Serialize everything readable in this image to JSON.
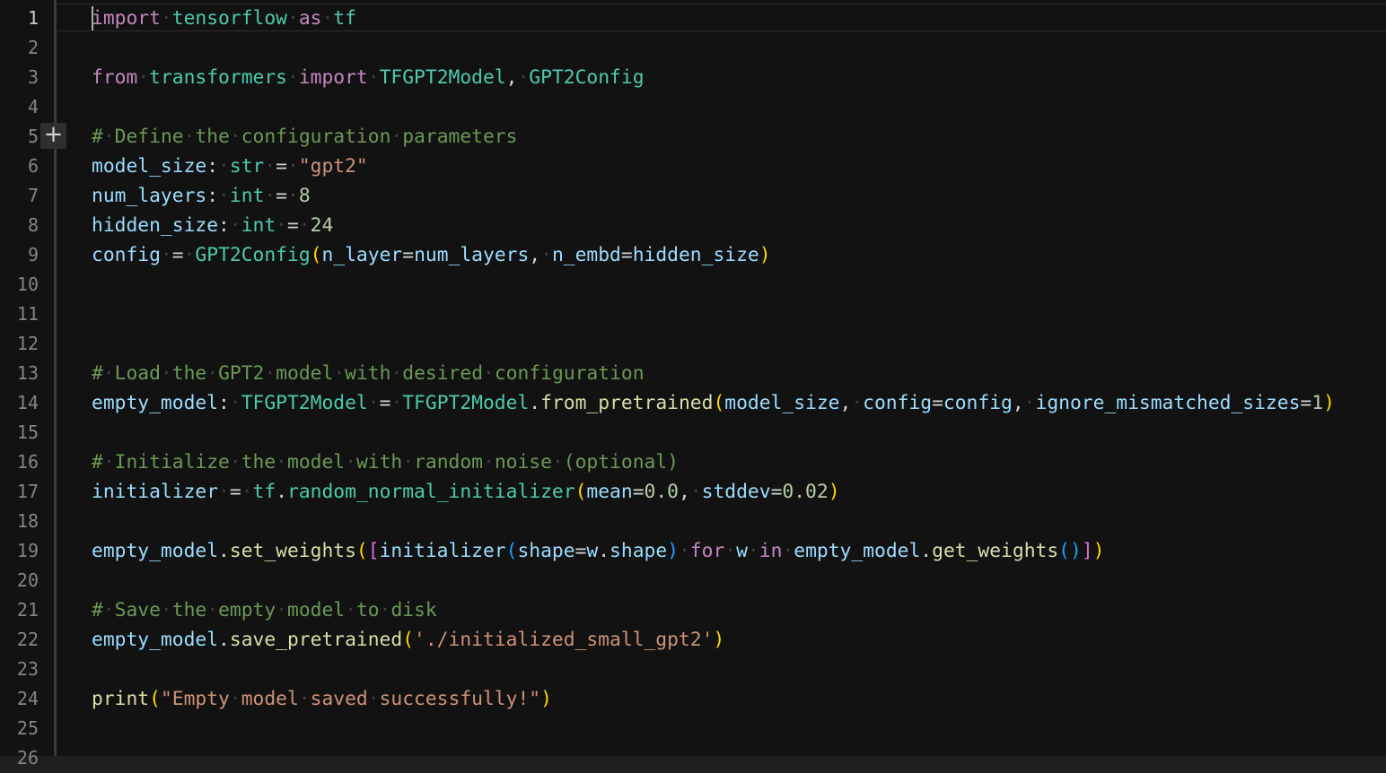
{
  "editor": {
    "line_numbers": [
      "1",
      "2",
      "3",
      "4",
      "5",
      "6",
      "7",
      "8",
      "9",
      "10",
      "11",
      "12",
      "13",
      "14",
      "15",
      "16",
      "17",
      "18",
      "19",
      "20",
      "21",
      "22",
      "23",
      "24",
      "25",
      "26"
    ],
    "active_line": 1,
    "gutter_action_icon": "add-icon",
    "code_lines": [
      {
        "line": 1,
        "tokens": [
          {
            "t": "import",
            "c": "kw-import"
          },
          {
            "t": "·",
            "c": "ws"
          },
          {
            "t": "tensorflow",
            "c": "ty"
          },
          {
            "t": "·",
            "c": "ws"
          },
          {
            "t": "as",
            "c": "kw-import"
          },
          {
            "t": "·",
            "c": "ws"
          },
          {
            "t": "tf",
            "c": "ty"
          }
        ]
      },
      {
        "line": 3,
        "tokens": [
          {
            "t": "from",
            "c": "kw-import"
          },
          {
            "t": "·",
            "c": "ws"
          },
          {
            "t": "transformers",
            "c": "ty"
          },
          {
            "t": "·",
            "c": "ws"
          },
          {
            "t": "import",
            "c": "kw-import"
          },
          {
            "t": "·",
            "c": "ws"
          },
          {
            "t": "TFGPT2Model",
            "c": "ty"
          },
          {
            "t": ",",
            "c": "op"
          },
          {
            "t": "·",
            "c": "ws"
          },
          {
            "t": "GPT2Config",
            "c": "ty"
          }
        ]
      },
      {
        "line": 5,
        "tokens": [
          {
            "t": "#",
            "c": "cm"
          },
          {
            "t": "·",
            "c": "ws"
          },
          {
            "t": "Define",
            "c": "cm"
          },
          {
            "t": "·",
            "c": "ws"
          },
          {
            "t": "the",
            "c": "cm"
          },
          {
            "t": "·",
            "c": "ws"
          },
          {
            "t": "configuration",
            "c": "cm"
          },
          {
            "t": "·",
            "c": "ws"
          },
          {
            "t": "parameters",
            "c": "cm"
          }
        ]
      },
      {
        "line": 6,
        "tokens": [
          {
            "t": "model_size",
            "c": "var"
          },
          {
            "t": ":",
            "c": "op"
          },
          {
            "t": "·",
            "c": "ws"
          },
          {
            "t": "str",
            "c": "ty"
          },
          {
            "t": "·",
            "c": "ws"
          },
          {
            "t": "=",
            "c": "op"
          },
          {
            "t": "·",
            "c": "ws"
          },
          {
            "t": "\"gpt2\"",
            "c": "str"
          }
        ]
      },
      {
        "line": 7,
        "tokens": [
          {
            "t": "num_layers",
            "c": "var"
          },
          {
            "t": ":",
            "c": "op"
          },
          {
            "t": "·",
            "c": "ws"
          },
          {
            "t": "int",
            "c": "ty"
          },
          {
            "t": "·",
            "c": "ws"
          },
          {
            "t": "=",
            "c": "op"
          },
          {
            "t": "·",
            "c": "ws"
          },
          {
            "t": "8",
            "c": "num"
          }
        ]
      },
      {
        "line": 8,
        "tokens": [
          {
            "t": "hidden_size",
            "c": "var"
          },
          {
            "t": ":",
            "c": "op"
          },
          {
            "t": "·",
            "c": "ws"
          },
          {
            "t": "int",
            "c": "ty"
          },
          {
            "t": "·",
            "c": "ws"
          },
          {
            "t": "=",
            "c": "op"
          },
          {
            "t": "·",
            "c": "ws"
          },
          {
            "t": "24",
            "c": "num"
          }
        ]
      },
      {
        "line": 9,
        "tokens": [
          {
            "t": "config",
            "c": "var"
          },
          {
            "t": "·",
            "c": "ws"
          },
          {
            "t": "=",
            "c": "op"
          },
          {
            "t": "·",
            "c": "ws"
          },
          {
            "t": "GPT2Config",
            "c": "ty"
          },
          {
            "t": "(",
            "c": "br1"
          },
          {
            "t": "n_layer",
            "c": "var"
          },
          {
            "t": "=",
            "c": "op"
          },
          {
            "t": "num_layers",
            "c": "var"
          },
          {
            "t": ",",
            "c": "op"
          },
          {
            "t": "·",
            "c": "ws"
          },
          {
            "t": "n_embd",
            "c": "var"
          },
          {
            "t": "=",
            "c": "op"
          },
          {
            "t": "hidden_size",
            "c": "var"
          },
          {
            "t": ")",
            "c": "br1"
          }
        ]
      },
      {
        "line": 13,
        "tokens": [
          {
            "t": "#",
            "c": "cm"
          },
          {
            "t": "·",
            "c": "ws"
          },
          {
            "t": "Load",
            "c": "cm"
          },
          {
            "t": "·",
            "c": "ws"
          },
          {
            "t": "the",
            "c": "cm"
          },
          {
            "t": "·",
            "c": "ws"
          },
          {
            "t": "GPT2",
            "c": "cm"
          },
          {
            "t": "·",
            "c": "ws"
          },
          {
            "t": "model",
            "c": "cm"
          },
          {
            "t": "·",
            "c": "ws"
          },
          {
            "t": "with",
            "c": "cm"
          },
          {
            "t": "·",
            "c": "ws"
          },
          {
            "t": "desired",
            "c": "cm"
          },
          {
            "t": "·",
            "c": "ws"
          },
          {
            "t": "configuration",
            "c": "cm"
          }
        ]
      },
      {
        "line": 14,
        "tokens": [
          {
            "t": "empty_model",
            "c": "var"
          },
          {
            "t": ":",
            "c": "op"
          },
          {
            "t": "·",
            "c": "ws"
          },
          {
            "t": "TFGPT2Model",
            "c": "ty"
          },
          {
            "t": "·",
            "c": "ws"
          },
          {
            "t": "=",
            "c": "op"
          },
          {
            "t": "·",
            "c": "ws"
          },
          {
            "t": "TFGPT2Model",
            "c": "ty"
          },
          {
            "t": ".",
            "c": "op"
          },
          {
            "t": "from_pretrained",
            "c": "fn"
          },
          {
            "t": "(",
            "c": "br1"
          },
          {
            "t": "model_size",
            "c": "var"
          },
          {
            "t": ",",
            "c": "op"
          },
          {
            "t": "·",
            "c": "ws"
          },
          {
            "t": "config",
            "c": "var"
          },
          {
            "t": "=",
            "c": "op"
          },
          {
            "t": "config",
            "c": "var"
          },
          {
            "t": ",",
            "c": "op"
          },
          {
            "t": "·",
            "c": "ws"
          },
          {
            "t": "ignore_mismatched_sizes",
            "c": "var"
          },
          {
            "t": "=",
            "c": "op"
          },
          {
            "t": "1",
            "c": "num"
          },
          {
            "t": ")",
            "c": "br1"
          }
        ]
      },
      {
        "line": 16,
        "tokens": [
          {
            "t": "#",
            "c": "cm"
          },
          {
            "t": "·",
            "c": "ws"
          },
          {
            "t": "Initialize",
            "c": "cm"
          },
          {
            "t": "·",
            "c": "ws"
          },
          {
            "t": "the",
            "c": "cm"
          },
          {
            "t": "·",
            "c": "ws"
          },
          {
            "t": "model",
            "c": "cm"
          },
          {
            "t": "·",
            "c": "ws"
          },
          {
            "t": "with",
            "c": "cm"
          },
          {
            "t": "·",
            "c": "ws"
          },
          {
            "t": "random",
            "c": "cm"
          },
          {
            "t": "·",
            "c": "ws"
          },
          {
            "t": "noise",
            "c": "cm"
          },
          {
            "t": "·",
            "c": "ws"
          },
          {
            "t": "(optional)",
            "c": "cm"
          }
        ]
      },
      {
        "line": 17,
        "tokens": [
          {
            "t": "initializer",
            "c": "var"
          },
          {
            "t": "·",
            "c": "ws"
          },
          {
            "t": "=",
            "c": "op"
          },
          {
            "t": "·",
            "c": "ws"
          },
          {
            "t": "tf",
            "c": "ty"
          },
          {
            "t": ".",
            "c": "op"
          },
          {
            "t": "random_normal_initializer",
            "c": "ty"
          },
          {
            "t": "(",
            "c": "br1"
          },
          {
            "t": "mean",
            "c": "var"
          },
          {
            "t": "=",
            "c": "op"
          },
          {
            "t": "0.0",
            "c": "num"
          },
          {
            "t": ",",
            "c": "op"
          },
          {
            "t": "·",
            "c": "ws"
          },
          {
            "t": "stddev",
            "c": "var"
          },
          {
            "t": "=",
            "c": "op"
          },
          {
            "t": "0.02",
            "c": "num"
          },
          {
            "t": ")",
            "c": "br1"
          }
        ]
      },
      {
        "line": 19,
        "tokens": [
          {
            "t": "empty_model",
            "c": "var"
          },
          {
            "t": ".",
            "c": "op"
          },
          {
            "t": "set_weights",
            "c": "fn"
          },
          {
            "t": "(",
            "c": "br1"
          },
          {
            "t": "[",
            "c": "br2"
          },
          {
            "t": "initializer",
            "c": "var"
          },
          {
            "t": "(",
            "c": "br3"
          },
          {
            "t": "shape",
            "c": "var"
          },
          {
            "t": "=",
            "c": "op"
          },
          {
            "t": "w",
            "c": "var"
          },
          {
            "t": ".",
            "c": "op"
          },
          {
            "t": "shape",
            "c": "var"
          },
          {
            "t": ")",
            "c": "br3"
          },
          {
            "t": "·",
            "c": "ws"
          },
          {
            "t": "for",
            "c": "kw-import"
          },
          {
            "t": "·",
            "c": "ws"
          },
          {
            "t": "w",
            "c": "var"
          },
          {
            "t": "·",
            "c": "ws"
          },
          {
            "t": "in",
            "c": "kw-import"
          },
          {
            "t": "·",
            "c": "ws"
          },
          {
            "t": "empty_model",
            "c": "var"
          },
          {
            "t": ".",
            "c": "op"
          },
          {
            "t": "get_weights",
            "c": "fn"
          },
          {
            "t": "()",
            "c": "br3"
          },
          {
            "t": "]",
            "c": "br2"
          },
          {
            "t": ")",
            "c": "br1"
          }
        ]
      },
      {
        "line": 21,
        "tokens": [
          {
            "t": "#",
            "c": "cm"
          },
          {
            "t": "·",
            "c": "ws"
          },
          {
            "t": "Save",
            "c": "cm"
          },
          {
            "t": "·",
            "c": "ws"
          },
          {
            "t": "the",
            "c": "cm"
          },
          {
            "t": "·",
            "c": "ws"
          },
          {
            "t": "empty",
            "c": "cm"
          },
          {
            "t": "·",
            "c": "ws"
          },
          {
            "t": "model",
            "c": "cm"
          },
          {
            "t": "·",
            "c": "ws"
          },
          {
            "t": "to",
            "c": "cm"
          },
          {
            "t": "·",
            "c": "ws"
          },
          {
            "t": "disk",
            "c": "cm"
          }
        ]
      },
      {
        "line": 22,
        "tokens": [
          {
            "t": "empty_model",
            "c": "var"
          },
          {
            "t": ".",
            "c": "op"
          },
          {
            "t": "save_pretrained",
            "c": "fn"
          },
          {
            "t": "(",
            "c": "br1"
          },
          {
            "t": "'./initialized_small_gpt2'",
            "c": "str"
          },
          {
            "t": ")",
            "c": "br1"
          }
        ]
      },
      {
        "line": 24,
        "tokens": [
          {
            "t": "print",
            "c": "fn"
          },
          {
            "t": "(",
            "c": "br1"
          },
          {
            "t": "\"Empty",
            "c": "str"
          },
          {
            "t": "·",
            "c": "ws"
          },
          {
            "t": "model",
            "c": "str"
          },
          {
            "t": "·",
            "c": "ws"
          },
          {
            "t": "saved",
            "c": "str"
          },
          {
            "t": "·",
            "c": "ws"
          },
          {
            "t": "successfully!\"",
            "c": "str"
          },
          {
            "t": ")",
            "c": "br1"
          }
        ]
      }
    ]
  }
}
